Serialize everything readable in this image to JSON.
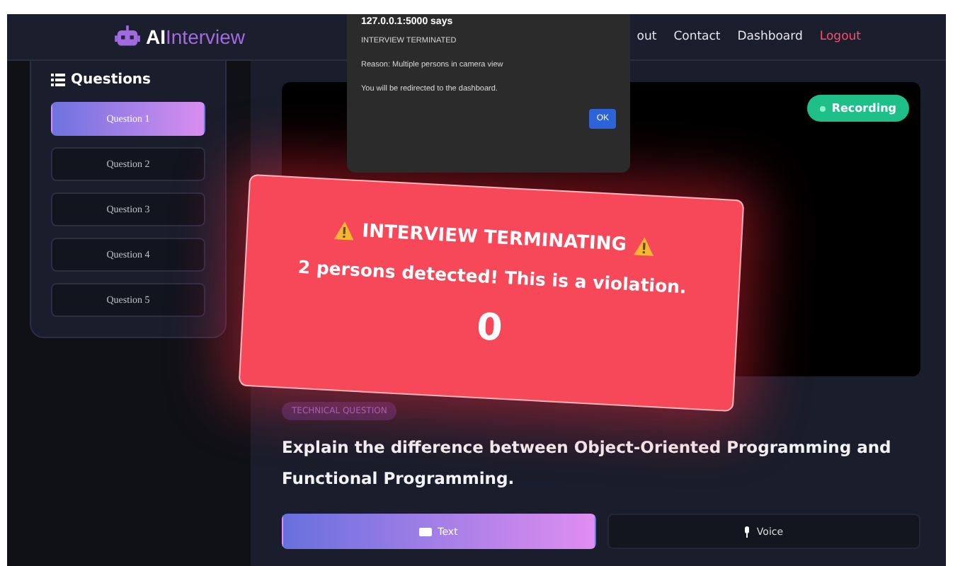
{
  "nav": {
    "logo": {
      "part1": "AI",
      "part2": "Interview"
    },
    "links": [
      {
        "label": "out",
        "kind": "normal"
      },
      {
        "label": "Contact",
        "kind": "normal"
      },
      {
        "label": "Dashboard",
        "kind": "normal"
      },
      {
        "label": "Logout",
        "kind": "danger"
      }
    ]
  },
  "sidebar": {
    "title": "Questions",
    "items": [
      {
        "label": "Question 1",
        "selected": true
      },
      {
        "label": "Question 2",
        "selected": false
      },
      {
        "label": "Question 3",
        "selected": false
      },
      {
        "label": "Question 4",
        "selected": false
      },
      {
        "label": "Question 5",
        "selected": false
      }
    ]
  },
  "video": {
    "recording": {
      "label": "Recording",
      "on": true
    }
  },
  "question": {
    "tag": "TECHNICAL QUESTION",
    "text": "Explain the difference between Object-Oriented Programming and Functional Programming."
  },
  "answer_modes": [
    {
      "label": "Text",
      "kind": "text",
      "selected": true
    },
    {
      "label": "Voice",
      "kind": "voice",
      "selected": false
    }
  ],
  "warning": {
    "title": "INTERVIEW TERMINATING",
    "message": "2 persons detected! This is a violation.",
    "count": "0"
  },
  "alert": {
    "origin": "127.0.0.1:5000 says",
    "lines": [
      "INTERVIEW TERMINATED",
      "Reason: Multiple persons in camera view",
      "You will be redirected to the dashboard."
    ],
    "button": "OK"
  }
}
